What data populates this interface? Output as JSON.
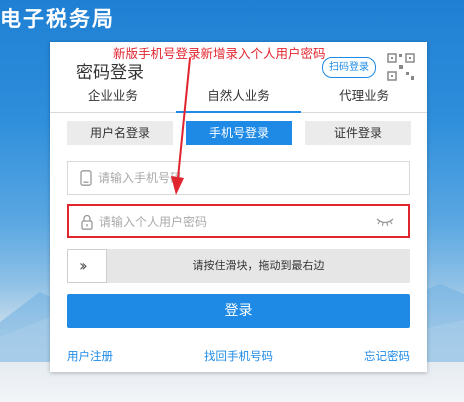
{
  "site": {
    "title": "电子税务局"
  },
  "login": {
    "title": "密码登录",
    "qr_button": "扫码登录",
    "qr_icon": "qr-code-icon",
    "tabs": [
      "企业业务",
      "自然人业务",
      "代理业务"
    ],
    "active_tab": "自然人业务",
    "subtabs": [
      "用户名登录",
      "手机号登录",
      "证件登录"
    ],
    "active_subtab": "手机号登录",
    "phone_placeholder": "请输入手机号码",
    "password_placeholder": "请输入个人用户密码",
    "slider_text": "请按住滑块，拖动到最右边",
    "login_button": "登录",
    "links": {
      "register": "用户注册",
      "recover_phone": "找回手机号码",
      "forgot_password": "忘记密码"
    }
  },
  "annotation": {
    "text": "新版手机号登录新增录入个人用户密码",
    "color": "#e0252f"
  },
  "colors": {
    "accent": "#1e8ae5",
    "highlight": "#e0252f"
  }
}
